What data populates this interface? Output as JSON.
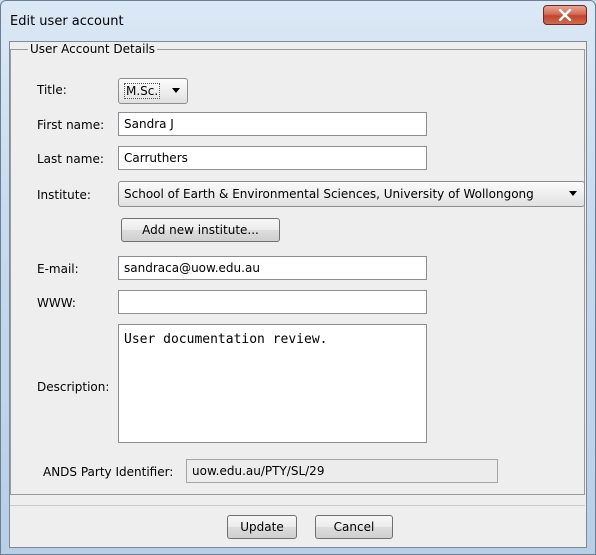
{
  "window": {
    "title": "Edit user account"
  },
  "group": {
    "legend": "User Account Details"
  },
  "form": {
    "title": {
      "label": "Title:",
      "value": "M.Sc."
    },
    "first_name": {
      "label": "First name:",
      "value": "Sandra J"
    },
    "last_name": {
      "label": "Last name:",
      "value": "Carruthers"
    },
    "institute": {
      "label": "Institute:",
      "value": "School of Earth & Environmental Sciences, University of Wollongong"
    },
    "add_institute_label": "Add new institute...",
    "email": {
      "label": "E-mail:",
      "value": "sandraca@uow.edu.au"
    },
    "www": {
      "label": "WWW:",
      "value": ""
    },
    "description": {
      "label": "Description:",
      "value": "User documentation review."
    },
    "ands": {
      "label": "ANDS Party Identifier:",
      "value": "uow.edu.au/PTY/SL/29"
    }
  },
  "actions": {
    "update_label": "Update",
    "cancel_label": "Cancel"
  },
  "icons": {
    "close": "close-icon",
    "dropdown": "chevron-down-icon"
  },
  "colors": {
    "close_button": "#c2452c",
    "dialog_background": "#eeeeee"
  }
}
